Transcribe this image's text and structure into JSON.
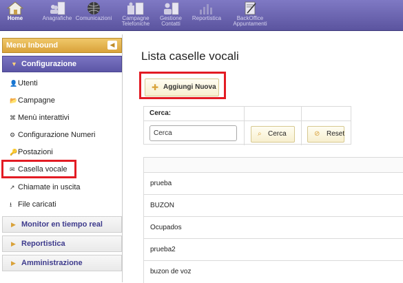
{
  "topnav": {
    "items": [
      {
        "label": "Home",
        "label2": "",
        "icon": "home-icon"
      },
      {
        "label": "Anagrafiche",
        "label2": "",
        "icon": "contacts-icon"
      },
      {
        "label": "Comunicazioni",
        "label2": "",
        "icon": "globe-icon"
      },
      {
        "label": "Campagne",
        "label2": "Telefoniche",
        "icon": "campaign-icon"
      },
      {
        "label": "Gestione",
        "label2": "Contatti",
        "icon": "contact-manage-icon"
      },
      {
        "label": "Reportistica",
        "label2": "",
        "icon": "bar-chart-icon"
      },
      {
        "label": "BackOffice",
        "label2": "Appuntamenti",
        "icon": "edit-doc-icon"
      }
    ]
  },
  "sidebar": {
    "menu_title": "Menu Inbound",
    "sections": [
      {
        "label": "Configurazione",
        "open": true
      },
      {
        "label": "Monitor en tiempo real",
        "open": false
      },
      {
        "label": "Reportistica",
        "open": false
      },
      {
        "label": "Amministrazione",
        "open": false
      }
    ],
    "items": [
      {
        "label": "Utenti",
        "icon": "user-icon",
        "glyph": "👤"
      },
      {
        "label": "Campagne",
        "icon": "folder-icon",
        "glyph": "📂"
      },
      {
        "label": "Menù interattivi",
        "icon": "menu-tree-icon",
        "glyph": "⌘"
      },
      {
        "label": "Configurazione Numeri",
        "icon": "gear-icon",
        "glyph": "⚙"
      },
      {
        "label": "Postazioni",
        "icon": "key-icon",
        "glyph": "🔑"
      },
      {
        "label": "Casella vocale",
        "icon": "envelope-icon",
        "glyph": "✉"
      },
      {
        "label": "Chiamate in uscita",
        "icon": "outgoing-call-icon",
        "glyph": "↗"
      },
      {
        "label": "File caricati",
        "icon": "upload-icon",
        "glyph": "⭳"
      }
    ]
  },
  "main": {
    "title": "Lista caselle vocali",
    "add_button": "Aggiungi Nuova",
    "search": {
      "label": "Cerca:",
      "input_value": "Cerca",
      "search_button": "Cerca",
      "reset_button": "Reset"
    },
    "rows": [
      "prueba",
      "BUZON",
      "Ocupados",
      "prueba2",
      "buzon de voz"
    ]
  },
  "colors": {
    "nav_bar": "#6a64b2",
    "accent_gold": "#d9a23a",
    "highlight_red": "#e31b23"
  }
}
